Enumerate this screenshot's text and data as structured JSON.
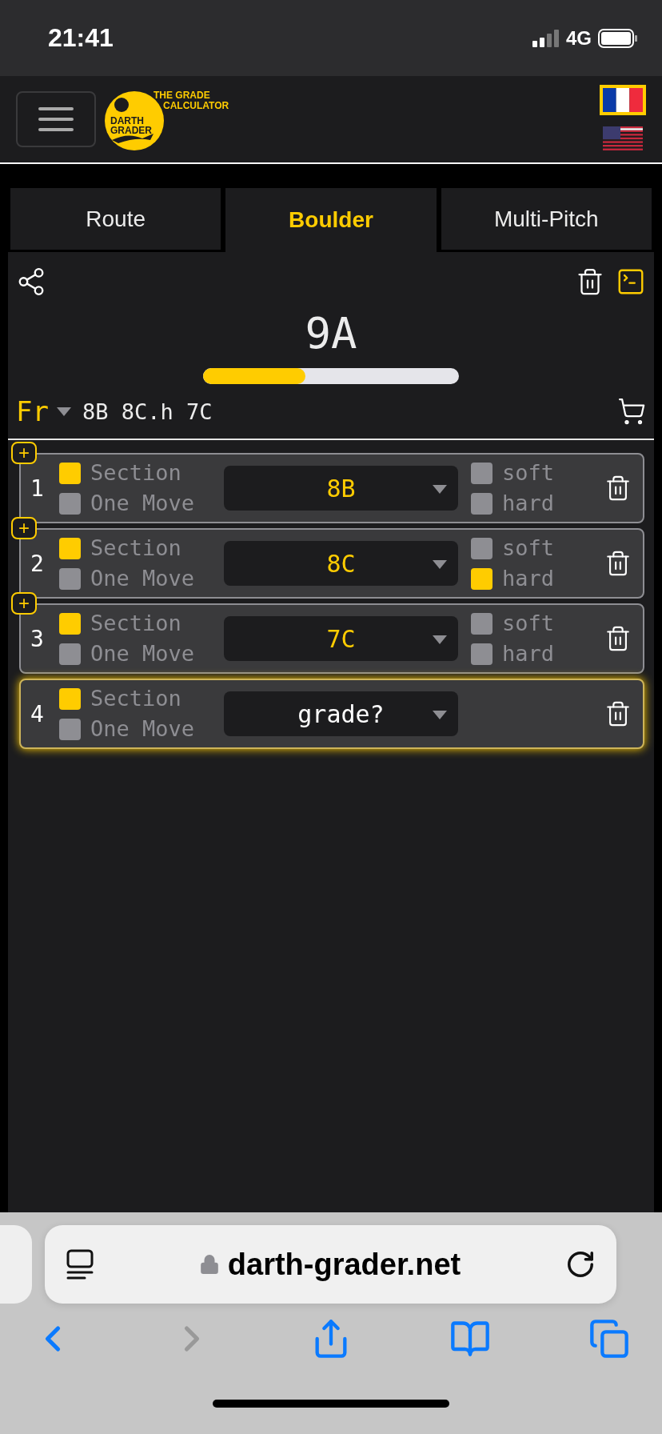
{
  "status_bar": {
    "time": "21:41",
    "network": "4G"
  },
  "header": {
    "logo": {
      "tagline_1": "THE GRADE",
      "tagline_2": "CALCULATOR",
      "name_1": "DARTH",
      "name_2": "GRADER"
    },
    "languages": [
      {
        "kind": "fr",
        "selected": true
      },
      {
        "kind": "us",
        "selected": false
      }
    ]
  },
  "tabs": [
    {
      "label": "Route",
      "selected": false
    },
    {
      "label": "Boulder",
      "selected": true
    },
    {
      "label": "Multi-Pitch",
      "selected": false
    }
  ],
  "result": {
    "grade": "9A",
    "level": 0.4
  },
  "scale": {
    "system": "Fr",
    "summary": "8B 8C.h 7C"
  },
  "rows": [
    {
      "number": "1",
      "add_button": "+",
      "focused": false,
      "options": [
        {
          "label": "Section",
          "checked": true
        },
        {
          "label": "One Move",
          "checked": false
        }
      ],
      "grade": "8B",
      "grade_set": true,
      "modifiers": [
        {
          "label": "soft",
          "checked": false
        },
        {
          "label": "hard",
          "checked": false
        }
      ]
    },
    {
      "number": "2",
      "add_button": "+",
      "focused": false,
      "options": [
        {
          "label": "Section",
          "checked": true
        },
        {
          "label": "One Move",
          "checked": false
        }
      ],
      "grade": "8C",
      "grade_set": true,
      "modifiers": [
        {
          "label": "soft",
          "checked": false
        },
        {
          "label": "hard",
          "checked": true
        }
      ]
    },
    {
      "number": "3",
      "add_button": "+",
      "focused": false,
      "options": [
        {
          "label": "Section",
          "checked": true
        },
        {
          "label": "One Move",
          "checked": false
        }
      ],
      "grade": "7C",
      "grade_set": true,
      "modifiers": [
        {
          "label": "soft",
          "checked": false
        },
        {
          "label": "hard",
          "checked": false
        }
      ]
    },
    {
      "number": "4",
      "focused": true,
      "options": [
        {
          "label": "Section",
          "checked": true
        },
        {
          "label": "One Move",
          "checked": false
        }
      ],
      "grade": "grade?",
      "grade_set": false
    }
  ],
  "browser": {
    "url": "darth-grader.net",
    "back_enabled": true,
    "forward_enabled": false
  }
}
